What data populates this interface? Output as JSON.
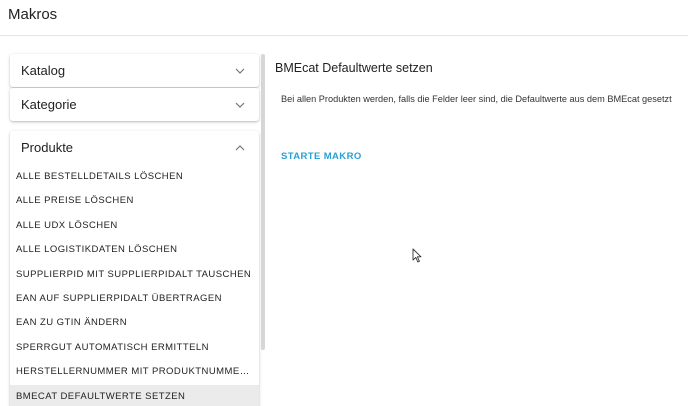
{
  "header": {
    "title": "Makros"
  },
  "sidebar": {
    "panels": [
      {
        "label": "Katalog",
        "expanded": false,
        "icon": "chevron-down-icon"
      },
      {
        "label": "Kategorie",
        "expanded": false,
        "icon": "chevron-down-icon"
      },
      {
        "label": "Produkte",
        "expanded": true,
        "icon": "chevron-up-icon"
      }
    ],
    "items": [
      "ALLE BESTELLDETAILS LÖSCHEN",
      "ALLE PREISE LÖSCHEN",
      "ALLE UDX LÖSCHEN",
      "ALLE LOGISTIKDATEN LÖSCHEN",
      "SUPPLIERPID MIT SUPPLIERPIDALT TAUSCHEN",
      "EAN AUF SUPPLIERPIDALT ÜBERTRAGEN",
      "EAN ZU GTIN ÄNDERN",
      "SPERRGUT AUTOMATISCH ERMITTELN",
      "HERSTELLERNUMMER MIT PRODUKTNUMMER FÜ...",
      "BMECAT DEFAULTWERTE SETZEN"
    ],
    "active_item": "BMECAT DEFAULTWERTE SETZEN"
  },
  "main": {
    "title": "BMEcat Defaultwerte setzen",
    "description": "Bei allen Produkten werden, falls die Felder leer sind, die Defaultwerte aus dem BMEcat gesetzt",
    "start_label": "STARTE MAKRO"
  },
  "colors": {
    "accent": "#2a9fd6",
    "active_row": "#ebebeb",
    "text": "#212121"
  }
}
